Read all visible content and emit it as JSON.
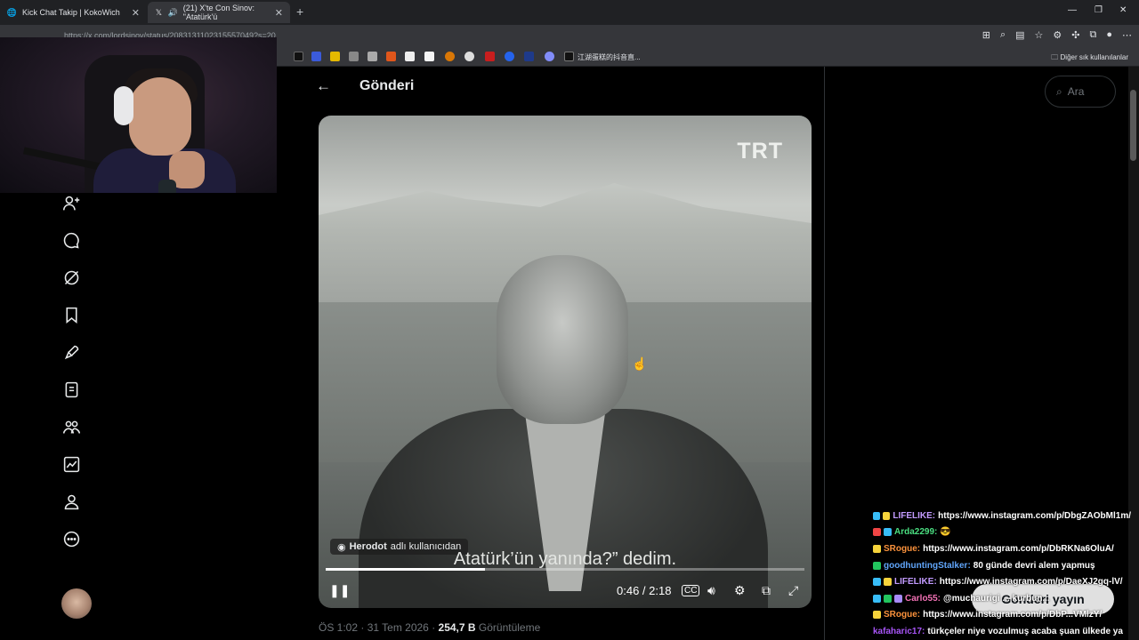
{
  "browser": {
    "tabs": [
      {
        "title": "Kick Chat Takip | KokoWich",
        "icon": "globe-icon",
        "active": false
      },
      {
        "title": "(21) X'te Con Sinov: \"Atatürk'ü",
        "icon": "x-logo-icon",
        "active": true
      }
    ],
    "url": "https://x.com/lordsinov/status/2083131102315557049?s=20",
    "bookmark_label": "江湖蛋糕的抖音直...",
    "bookmarks_other": "Diğer sık kullanılanlar"
  },
  "post": {
    "title": "Gönderi",
    "video": {
      "watermark": "TRT",
      "subtitle": "Atatürk’ün yanında?” dedim.",
      "attribution_user": "Herodot",
      "attribution_suffix": "adlı kullanıcıdan",
      "time": "0:46 / 2:18",
      "progress": 0.333
    },
    "meta_time": "ÖS 1:02 · 31 Tem 2026 · ",
    "meta_views": "254,7 B",
    "meta_views_label": " Görüntüleme"
  },
  "search": {
    "placeholder": "Ara"
  },
  "chat": [
    {
      "user": "LIFELIKE:",
      "user_color": "#c39bff",
      "msg": "https://www.instagram.com/p/DbgZAObMl1m/",
      "badges": [
        "#38bdf8",
        "#f6d33b"
      ]
    },
    {
      "user": "Arda2299:",
      "user_color": "#4ade80",
      "msg": "😎",
      "badges": [
        "#ef4444",
        "#38bdf8"
      ]
    },
    {
      "user": "SRogue:",
      "user_color": "#fb923c",
      "msg": "https://www.instagram.com/p/DbRKNa6OluA/",
      "badges": [
        "#f6d33b"
      ]
    },
    {
      "user": "goodhuntingStalker:",
      "user_color": "#60a5fa",
      "msg": "80 günde devri alem yapmuş",
      "badges": [
        "#22c55e"
      ]
    },
    {
      "user": "LIFELIKE:",
      "user_color": "#c39bff",
      "msg": "https://www.instagram.com/p/DaeXJ2gq-lV/",
      "badges": [
        "#38bdf8",
        "#f6d33b"
      ]
    },
    {
      "user": "Carlo55:",
      "user_color": "#f472b6",
      "msg": "@muchaurigi ... kurbun...",
      "badges": [
        "#38bdf8",
        "#22c55e",
        "#a78bfa"
      ]
    },
    {
      "user": "SRogue:",
      "user_color": "#fb923c",
      "msg": "https://www.instagram.com/p/DbP...VMlzY/",
      "badges": [
        "#f6d33b"
      ]
    },
    {
      "user": "kafaharic17:",
      "user_color": "#a855f7",
      "msg": "türkçeler niye vozulmuş acaba şuan ülkede ya",
      "badges": []
    }
  ],
  "follow_button": "Gönderi yayın",
  "colors": {
    "x_text": "#e7e9ea",
    "x_muted": "#71767b",
    "x_border": "#2f3336"
  }
}
